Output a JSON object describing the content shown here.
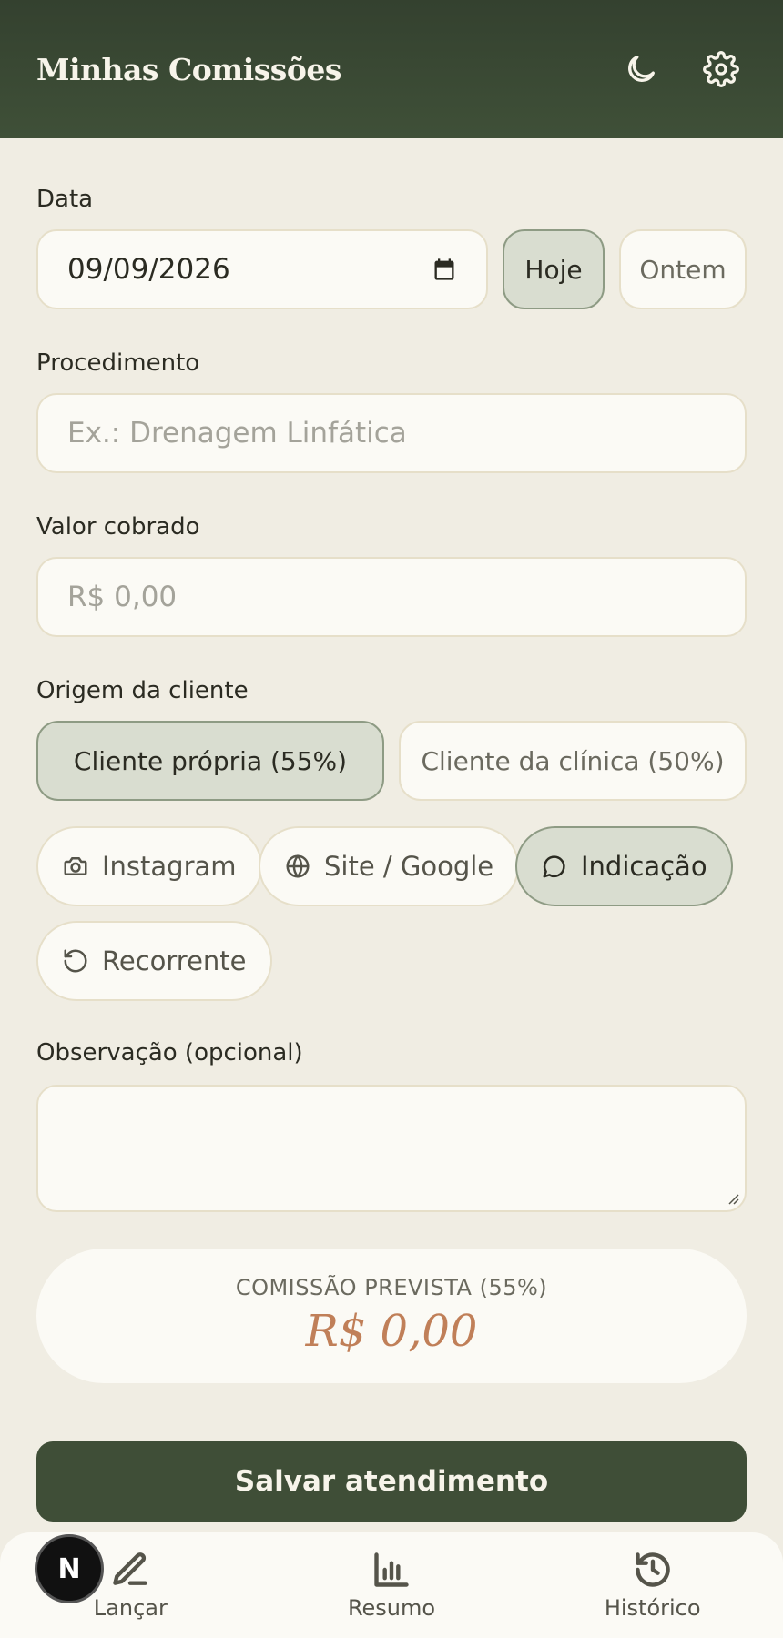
{
  "header": {
    "title": "Minhas Comissões",
    "theme_icon": "moon-icon",
    "settings_icon": "gear-icon"
  },
  "form": {
    "date": {
      "label": "Data",
      "value": "09/09/2026",
      "today_label": "Hoje",
      "yesterday_label": "Ontem",
      "selected": "Hoje"
    },
    "procedure": {
      "label": "Procedimento",
      "placeholder": "Ex.: Drenagem Linfática"
    },
    "amount": {
      "label": "Valor cobrado",
      "placeholder": "R$ 0,00"
    },
    "origin": {
      "label": "Origem da cliente",
      "options": [
        "Cliente própria (55%)",
        "Cliente da clínica (50%)"
      ],
      "selected": "Cliente própria (55%)"
    },
    "sources": {
      "items": [
        {
          "label": "Instagram",
          "icon": "camera-icon"
        },
        {
          "label": "Site / Google",
          "icon": "globe-icon"
        },
        {
          "label": "Indicação",
          "icon": "chat-bubble-icon"
        },
        {
          "label": "Recorrente",
          "icon": "refresh-icon"
        }
      ],
      "selected": "Indicação"
    },
    "note": {
      "label": "Observação (opcional)",
      "value": ""
    }
  },
  "commission": {
    "label": "COMISSÃO PREVISTA (55%)",
    "value": "R$ 0,00"
  },
  "save_label": "Salvar atendimento",
  "nav": {
    "items": [
      {
        "label": "Lançar",
        "icon": "pen-icon"
      },
      {
        "label": "Resumo",
        "icon": "bar-chart-icon"
      },
      {
        "label": "Histórico",
        "icon": "history-icon"
      }
    ],
    "badge": "N"
  },
  "colors": {
    "header": "#3f5038",
    "accent": "#c07f58",
    "primary": "#3f4e37",
    "background": "#f0ede3"
  }
}
